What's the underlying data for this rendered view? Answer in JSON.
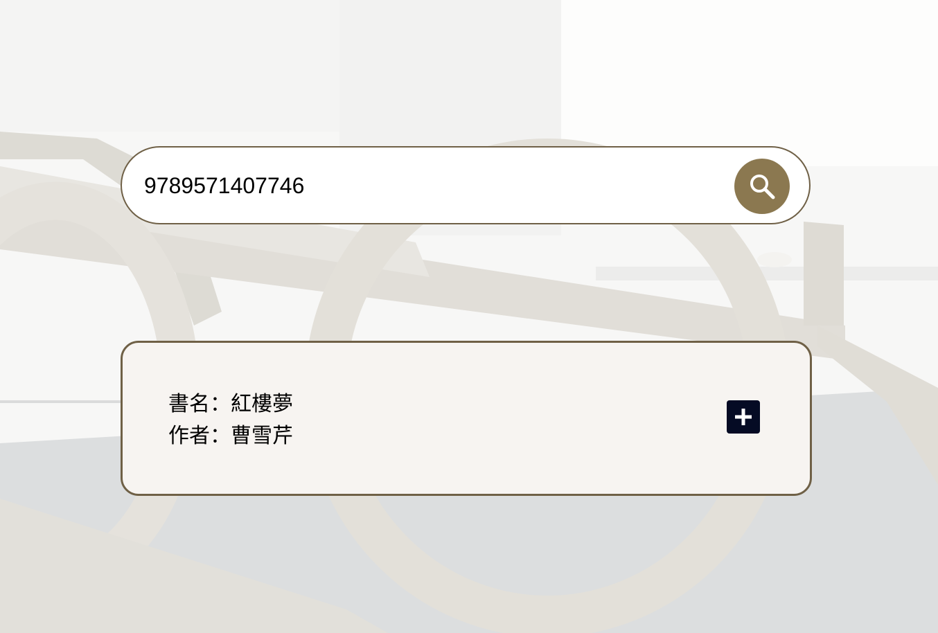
{
  "search": {
    "value": "9789571407746",
    "button_icon": "search-icon"
  },
  "result": {
    "title_label": "書名：",
    "title_value": "紅樓夢",
    "author_label": "作者：",
    "author_value": "曹雪芹",
    "add_icon": "plus-icon"
  },
  "colors": {
    "accent": "#8b7850",
    "border": "#6f6046",
    "card_background": "#f7f4f1",
    "add_button": "#050b24"
  }
}
